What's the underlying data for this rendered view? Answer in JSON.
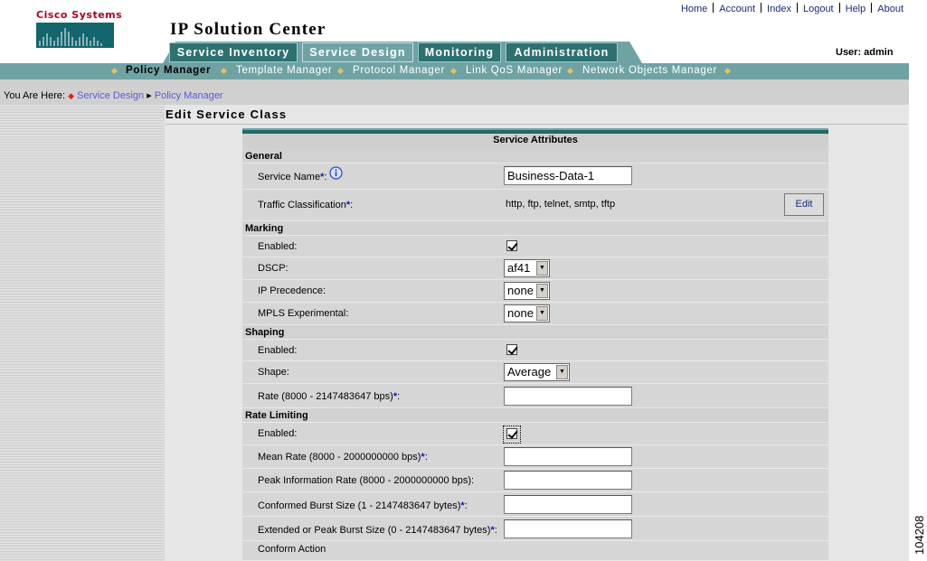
{
  "brand": {
    "logo_text": "Cisco Systems"
  },
  "app": {
    "title": "IP Solution Center"
  },
  "top_links": [
    "Home",
    "Account",
    "Index",
    "Logout",
    "Help",
    "About"
  ],
  "user": {
    "label": "User: admin"
  },
  "main_tabs": [
    {
      "label": "Service Inventory",
      "active": false
    },
    {
      "label": "Service Design",
      "active": true
    },
    {
      "label": "Monitoring",
      "active": false
    },
    {
      "label": "Administration",
      "active": false
    }
  ],
  "sub_nav": [
    {
      "label": "Policy Manager",
      "active": true
    },
    {
      "label": "Template Manager",
      "active": false
    },
    {
      "label": "Protocol Manager",
      "active": false
    },
    {
      "label": "Link QoS Manager",
      "active": false
    },
    {
      "label": "Network Objects Manager",
      "active": false
    }
  ],
  "breadcrumb": {
    "prefix": "You Are Here:",
    "items": [
      "Service Design",
      "Policy Manager"
    ]
  },
  "page": {
    "title": "Edit Service Class",
    "table_header": "Service Attributes"
  },
  "general": {
    "section": "General",
    "service_name_label": "Service Name",
    "service_name_value": "Business-Data-1",
    "traffic_label": "Traffic Classification",
    "traffic_value": "http, ftp, telnet, smtp, tftp",
    "edit_button": "Edit"
  },
  "marking": {
    "section": "Marking",
    "enabled_label": "Enabled:",
    "enabled_checked": true,
    "dscp_label": "DSCP:",
    "dscp_value": "af41",
    "ip_prec_label": "IP Precedence:",
    "ip_prec_value": "none",
    "mpls_label": "MPLS Experimental:",
    "mpls_value": "none"
  },
  "shaping": {
    "section": "Shaping",
    "enabled_label": "Enabled:",
    "enabled_checked": true,
    "shape_label": "Shape:",
    "shape_value": "Average",
    "rate_label": "Rate (8000  - 2147483647 bps)",
    "rate_value": ""
  },
  "rate_limiting": {
    "section": "Rate Limiting",
    "enabled_label": "Enabled:",
    "enabled_checked": true,
    "mean_rate_label": "Mean Rate (8000  - 2000000000 bps)",
    "mean_rate_value": "",
    "peak_rate_label": "Peak Information Rate (8000  - 2000000000 bps):",
    "peak_rate_value": "",
    "conformed_burst_label": "Conformed Burst Size (1  - 2147483647 bytes)",
    "conformed_burst_value": "",
    "extended_burst_label": "Extended or Peak Burst Size (0  - 2147483647 bytes)",
    "extended_burst_value": "",
    "conform_action_label": "Conform Action"
  },
  "figure_id": "104208",
  "colors": {
    "teal": "#6fa3a3",
    "dark_teal": "#2d7170",
    "link": "#1a2b7a",
    "required": "#1020c0",
    "brand_red": "#b00020"
  }
}
